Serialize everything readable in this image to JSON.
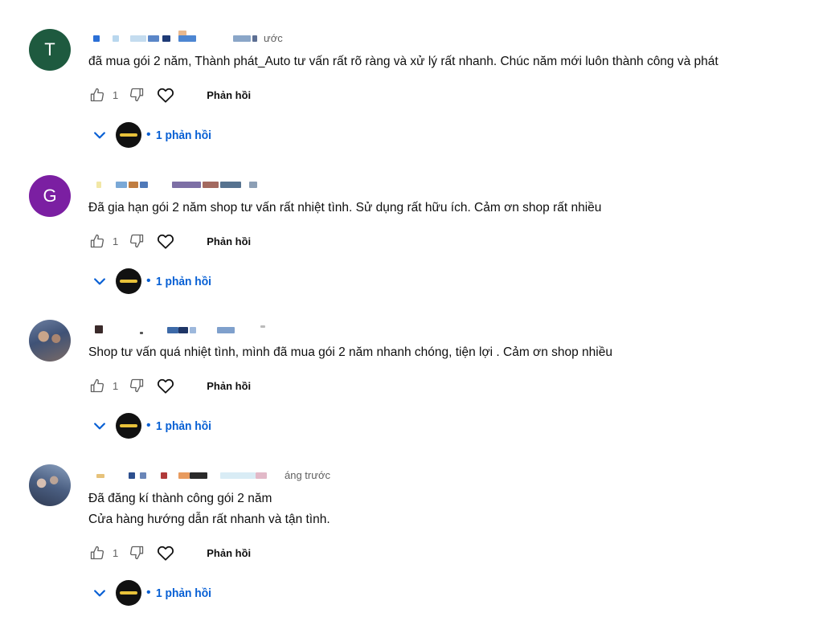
{
  "colors": {
    "link_blue": "#065fd4",
    "avatar_t": "#1e5a3f",
    "avatar_g": "#7b1fa2",
    "muted": "#606060"
  },
  "icons": {
    "like": "thumbs-up-outline-icon",
    "dislike": "thumbs-down-outline-icon",
    "heart": "heart-outline-icon",
    "expand": "chevron-down-icon"
  },
  "comments": [
    {
      "avatar_letter": "T",
      "time_fragment": "ước",
      "text_lines": [
        "đã mua gói 2 năm, Thành phát_Auto tư vấn rất rõ ràng và xử lý rất nhanh. Chúc năm mới luôn thành công và phát"
      ],
      "likes": "1",
      "reply_label": "Phản hồi",
      "replies_label": "1 phản hồi"
    },
    {
      "avatar_letter": "G",
      "time_fragment": "",
      "text_lines": [
        "Đã gia hạn gói 2 năm shop tư vấn rất nhiệt tình. Sử dụng rất hữu ích. Cảm ơn shop rất nhiều"
      ],
      "likes": "1",
      "reply_label": "Phản hồi",
      "replies_label": "1 phản hồi"
    },
    {
      "avatar_letter": "",
      "time_fragment": "",
      "text_lines": [
        "Shop tư vấn quá nhiệt tình, mình đã mua gói 2 năm nhanh chóng, tiện lợi . Cảm ơn shop nhiều"
      ],
      "likes": "1",
      "reply_label": "Phản hồi",
      "replies_label": "1 phản hồi"
    },
    {
      "avatar_letter": "",
      "time_fragment": "áng trước",
      "text_lines": [
        "Đã đăng kí thành công gói 2 năm",
        "Cửa hàng hướng dẫn rất nhanh và tận tình."
      ],
      "likes": "1",
      "reply_label": "Phản hồi",
      "replies_label": "1 phản hồi"
    }
  ]
}
